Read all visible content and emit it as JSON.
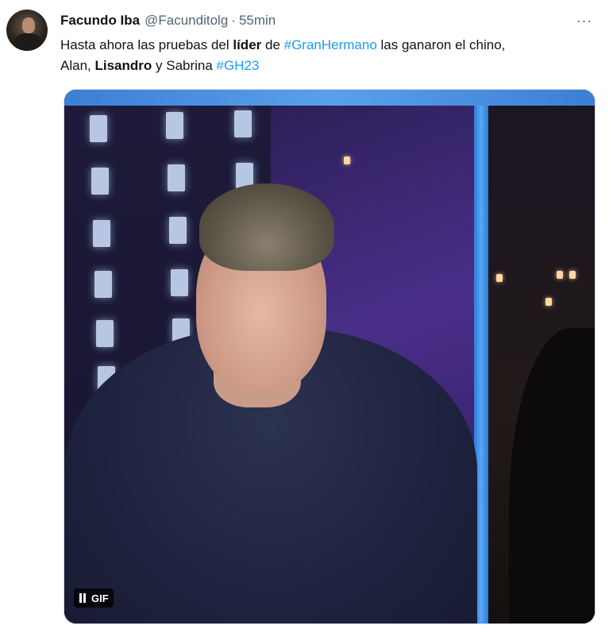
{
  "tweet": {
    "author": {
      "display_name": "Facundo Iba",
      "handle": "@Facunditolg",
      "separator": "·",
      "time": "55min"
    },
    "more_icon": "more-horizontal-icon",
    "more_glyph": "···",
    "text": {
      "line1": {
        "part1": "Hasta ahora las pruebas del ",
        "bold1": "líder",
        "part2": " de ",
        "hashtag1": "#GranHermano",
        "part3": " las ganaron el chino,"
      },
      "line2": {
        "part1": "Alan, ",
        "bold1": "Lisandro",
        "part2": " y Sabrina ",
        "hashtag1": "#GH23"
      }
    },
    "media": {
      "badge_label": "GIF",
      "pause_icon": "pause-icon"
    },
    "colors": {
      "hashtag": "#1d9bf0",
      "secondary_text": "#536471",
      "primary_text": "#0f1419"
    }
  }
}
